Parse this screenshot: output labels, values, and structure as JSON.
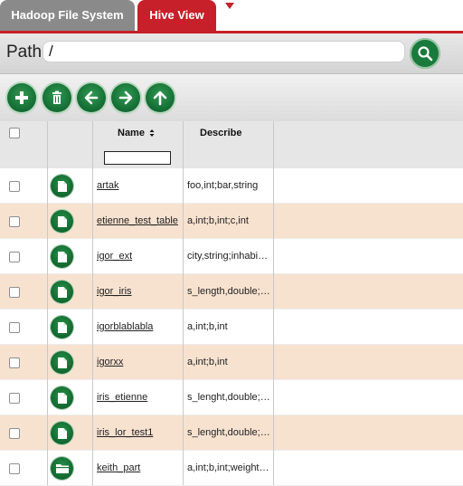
{
  "tabs": [
    {
      "label": "Hadoop File System",
      "active": false
    },
    {
      "label": "Hive View",
      "active": true
    }
  ],
  "path": {
    "label": "Path",
    "value": "/"
  },
  "toolbar": {
    "buttons": [
      {
        "name": "add-icon"
      },
      {
        "name": "trash-icon"
      },
      {
        "name": "back-arrow-icon"
      },
      {
        "name": "forward-arrow-icon"
      },
      {
        "name": "up-arrow-icon"
      }
    ]
  },
  "table": {
    "columns": {
      "name": "Name",
      "describe": "Describe"
    },
    "rows": [
      {
        "name": "artak",
        "describe": "foo,int;bar,string",
        "icon": "file-icon"
      },
      {
        "name": "etienne_test_table",
        "describe": "a,int;b,int;c,int",
        "icon": "file-icon"
      },
      {
        "name": "igor_ext",
        "describe": "city,string;inhabitants,int",
        "icon": "file-icon"
      },
      {
        "name": "igor_iris",
        "describe": "s_length,double;s_width,double",
        "icon": "file-icon"
      },
      {
        "name": "igorblablabla",
        "describe": "a,int;b,int",
        "icon": "file-icon"
      },
      {
        "name": "igorxx",
        "describe": "a,int;b,int",
        "icon": "file-icon"
      },
      {
        "name": "iris_etienne",
        "describe": "s_lenght,double;s_width,double",
        "icon": "file-icon"
      },
      {
        "name": "iris_lor_test1",
        "describe": "s_lenght,double;s_width,double",
        "icon": "file-icon"
      },
      {
        "name": "keith_part",
        "describe": "a,int;b,int;weight,double",
        "icon": "folder-icon"
      }
    ]
  },
  "colors": {
    "accent": "#c8202a",
    "button_green": "#1a7a3c",
    "row_alt": "#f7e2d0"
  }
}
